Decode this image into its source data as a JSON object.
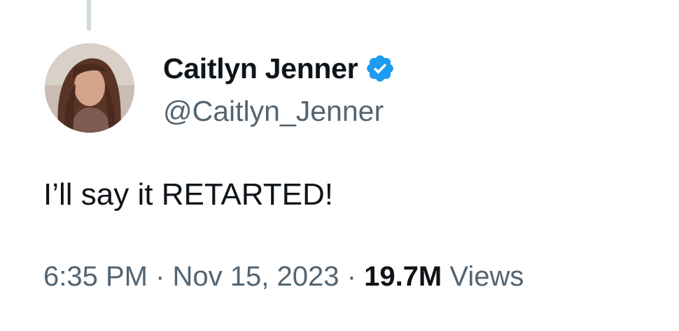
{
  "tweet": {
    "author": {
      "display_name": "Caitlyn Jenner",
      "handle": "@Caitlyn_Jenner",
      "verified": true,
      "verified_color": "#1d9bf0"
    },
    "text": "I’ll say it RETARTED!",
    "time": "6:35 PM",
    "separator": "·",
    "date": "Nov 15, 2023",
    "views_count": "19.7M",
    "views_label": "Views"
  },
  "colors": {
    "primary_text": "#0f1419",
    "secondary_text": "#536471",
    "thread_line": "#cfd9de",
    "background": "#ffffff"
  }
}
